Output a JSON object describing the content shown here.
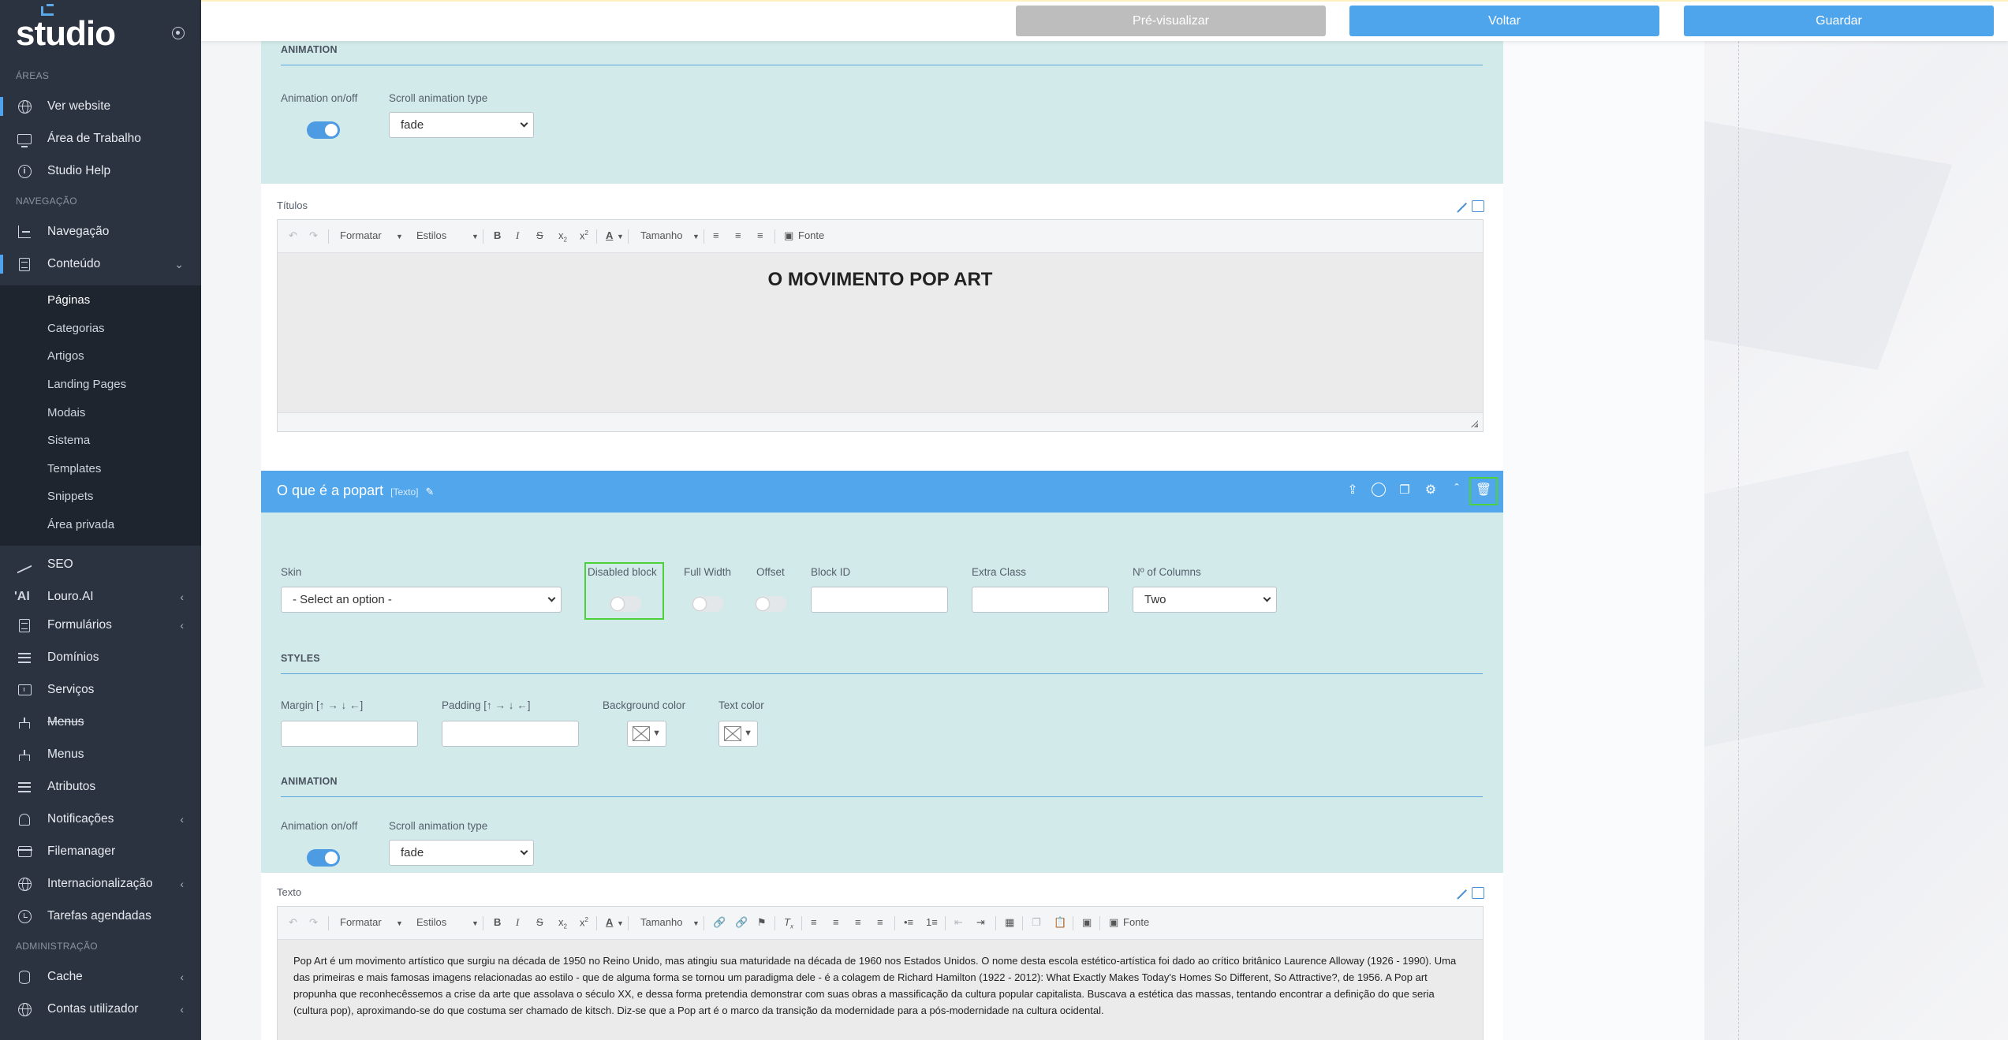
{
  "sidebar": {
    "logo": "studio",
    "sections": {
      "areas": "ÁREAS",
      "navegacao": "NAVEGAÇÃO",
      "administracao": "ADMINISTRAÇÃO"
    },
    "top_items": [
      {
        "label": "Ver website",
        "icon": "globe-icon"
      },
      {
        "label": "Área de Trabalho",
        "icon": "monitor-icon"
      },
      {
        "label": "Studio Help",
        "icon": "info-icon"
      }
    ],
    "nav_items": [
      {
        "label": "Navegação",
        "icon": "tree-icon"
      },
      {
        "label": "Conteúdo",
        "icon": "document-icon"
      }
    ],
    "content_submenu": [
      "Páginas",
      "Categorias",
      "Artigos",
      "Landing Pages",
      "Modais",
      "Sistema",
      "Templates",
      "Snippets",
      "Área privada"
    ],
    "more_items": [
      {
        "label": "SEO",
        "icon": "chart-icon"
      },
      {
        "label": "Louro.AI",
        "icon": "ai-icon"
      },
      {
        "label": "Formulários",
        "icon": "document-icon"
      },
      {
        "label": "Domínios",
        "icon": "list-icon"
      },
      {
        "label": "Serviços",
        "icon": "service-icon"
      },
      {
        "label": "Menus",
        "icon": "hierarchy-icon"
      },
      {
        "label": "Menus",
        "icon": "hierarchy-icon"
      },
      {
        "label": "Atributos",
        "icon": "list-icon"
      },
      {
        "label": "Notificações",
        "icon": "bell-icon"
      },
      {
        "label": "Filemanager",
        "icon": "box-icon"
      },
      {
        "label": "Internacionalização",
        "icon": "globe-icon"
      },
      {
        "label": "Tarefas agendadas",
        "icon": "clock-icon"
      }
    ],
    "admin_items": [
      {
        "label": "Cache",
        "icon": "database-icon"
      },
      {
        "label": "Contas utilizador",
        "icon": "users-icon"
      }
    ]
  },
  "topbar": {
    "preview_label": "Pré-visualizar",
    "back_label": "Voltar",
    "save_label": "Guardar"
  },
  "top_block": {
    "animation_heading": "ANIMATION",
    "animation_toggle_label": "Animation on/off",
    "scroll_type_label": "Scroll animation type",
    "scroll_type_value": "fade",
    "titles_label": "Títulos",
    "heading_text": "O MOVIMENTO POP ART"
  },
  "editor_toolbar": {
    "format": "Formatar",
    "styles": "Estilos",
    "size": "Tamanho",
    "source": "Fonte"
  },
  "text_block": {
    "title": "O que é a popart",
    "tag": "[Texto]",
    "skin_label": "Skin",
    "skin_value": "- Select an option -",
    "disabled_label": "Disabled block",
    "full_width_label": "Full Width",
    "offset_label": "Offset",
    "block_id_label": "Block ID",
    "extra_class_label": "Extra Class",
    "columns_label": "Nº of Columns",
    "columns_value": "Two",
    "styles_heading": "STYLES",
    "margin_label": "Margin [↑ → ↓ ←]",
    "padding_label": "Padding [↑ → ↓ ←]",
    "bg_color_label": "Background color",
    "text_color_label": "Text color",
    "animation_heading": "ANIMATION",
    "animation_toggle_label": "Animation on/off",
    "scroll_type_label": "Scroll animation type",
    "scroll_type_value": "fade",
    "text_label": "Texto",
    "paragraph": "Pop Art é um movimento artístico que surgiu na década de 1950 no Reino Unido, mas atingiu sua maturidade na década de 1960 nos Estados Unidos. O nome desta escola estético-artística foi dado ao crítico britânico Laurence Alloway (1926 - 1990). Uma das primeiras e mais famosas imagens relacionadas ao estilo - que de alguma forma se tornou um paradigma dele - é a colagem de Richard Hamilton (1922 - 2012): What Exactly Makes Today's Homes So Different, So Attractive?, de 1956. A Pop art propunha que reconhecêssemos a crise da arte que assolava o século XX, e dessa forma pretendia demonstrar com suas obras a massificação da cultura popular capitalista. Buscava a estética das massas, tentando encontrar a definição do que seria (cultura pop), aproximando-se do que costuma ser chamado de kitsch. Diz-se que a Pop art é o marco da transição da modernidade para a pós-modernidade na cultura ocidental."
  },
  "colors": {
    "sidebar_bg": "#2c3340",
    "accent": "#4ea5ec",
    "panel_bg": "#d2ebea",
    "highlight_border": "#4bd23a"
  }
}
